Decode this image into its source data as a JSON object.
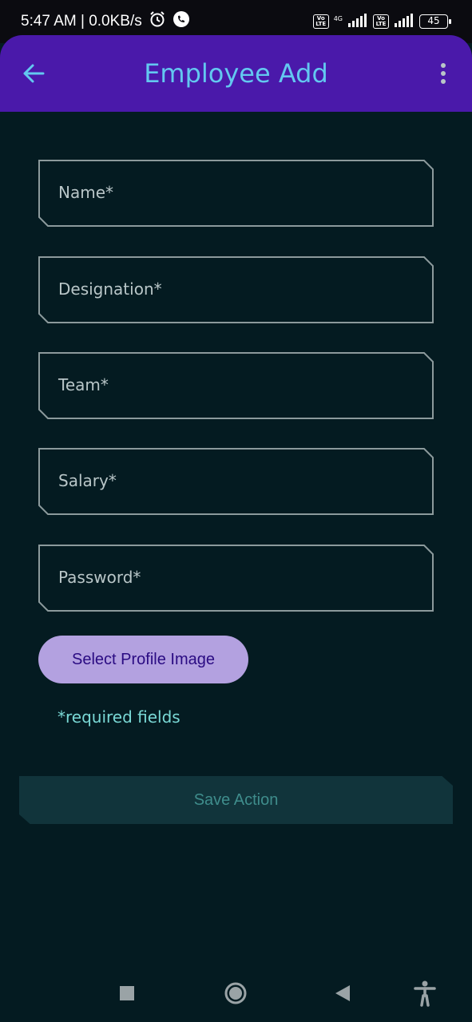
{
  "status": {
    "time_speed": "5:47 AM | 0.0KB/s",
    "battery": "45",
    "network": "4G"
  },
  "appbar": {
    "title": "Employee Add",
    "back_icon": "arrow-left-icon",
    "menu_icon": "more-vert-icon"
  },
  "form": {
    "fields": [
      {
        "label": "Name*"
      },
      {
        "label": "Designation*"
      },
      {
        "label": "Team*"
      },
      {
        "label": "Salary*"
      },
      {
        "label": "Password*"
      }
    ],
    "profile_button": "Select Profile Image",
    "required_note": "*required fields",
    "save_button": "Save Action"
  },
  "colors": {
    "background": "#041b21",
    "appbar": "#4a19aa",
    "title": "#63c8f0",
    "profile_button_bg": "#b3a1e0",
    "save_button_bg": "#11343b"
  }
}
